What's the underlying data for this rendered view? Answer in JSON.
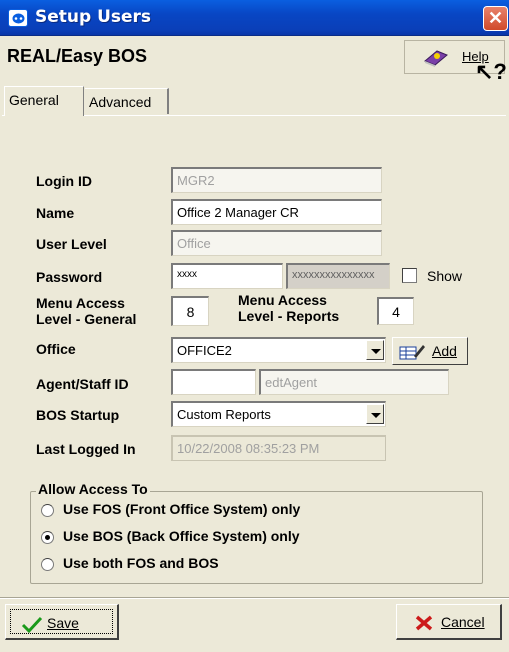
{
  "window": {
    "title": "Setup Users",
    "close_glyph": "✕"
  },
  "header": {
    "app_name": "REAL/Easy BOS",
    "help_label": "Help",
    "help_icon": "help-book-icon"
  },
  "tabs": [
    {
      "label": "General",
      "active": true
    },
    {
      "label": "Advanced",
      "active": false
    }
  ],
  "form": {
    "login_id": {
      "label": "Login ID",
      "value": "MGR2"
    },
    "name": {
      "label": "Name",
      "value": "Office 2 Manager CR"
    },
    "user_level": {
      "label": "User Level",
      "value": "Office"
    },
    "password": {
      "label": "Password",
      "value": "xxxx",
      "confirm_value": "xxxxxxxxxxxxxxx",
      "show_label": "Show"
    },
    "menu_access_general": {
      "label_line1": "Menu Access",
      "label_line2": "Level - General",
      "value": "8"
    },
    "menu_access_reports": {
      "label_line1": "Menu Access",
      "label_line2": "Level - Reports",
      "value": "4"
    },
    "office": {
      "label": "Office",
      "value": "OFFICE2",
      "add_label": "Add"
    },
    "agent_staff_id": {
      "label": "Agent/Staff ID",
      "value": "",
      "agent_value": "edtAgent"
    },
    "bos_startup": {
      "label": "BOS Startup",
      "value": "Custom Reports"
    },
    "last_logged_in": {
      "label": "Last Logged In",
      "value": "10/22/2008 08:35:23 PM"
    }
  },
  "access": {
    "title": "Allow Access To",
    "options": [
      {
        "label": "Use FOS (Front Office System) only",
        "selected": false
      },
      {
        "label": "Use BOS (Back Office System) only",
        "selected": true
      },
      {
        "label": "Use both FOS and BOS",
        "selected": false
      }
    ]
  },
  "buttons": {
    "save_label": "Save",
    "cancel_label": "Cancel"
  },
  "colors": {
    "titlebar": "#0a48cc",
    "dialog_bg": "#ece9d8",
    "cancel_x": "#cc1a1a",
    "save_check": "#1a9a1a"
  }
}
